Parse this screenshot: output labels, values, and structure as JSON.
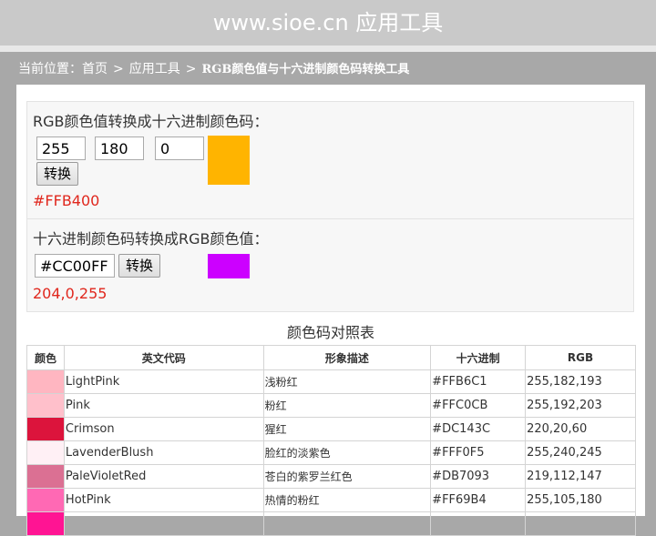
{
  "header": {
    "site_title": "www.sioe.cn 应用工具"
  },
  "breadcrumb": {
    "prefix": "当前位置：",
    "home": "首页",
    "tools": "应用工具",
    "separator": ">",
    "current": "RGB颜色值与十六进制颜色码转换工具"
  },
  "rgb_to_hex": {
    "title": "RGB颜色值转换成十六进制颜色码：",
    "r": "255",
    "g": "180",
    "b": "0",
    "button_label": "转换",
    "result": "#FFB400",
    "swatch_color": "#FFB400"
  },
  "hex_to_rgb": {
    "title": "十六进制颜色码转换成RGB颜色值：",
    "hex": "#CC00FF",
    "button_label": "转换",
    "result": "204,0,255",
    "swatch_color": "#CC00FF"
  },
  "table": {
    "caption": "颜色码对照表",
    "headers": [
      "颜色",
      "英文代码",
      "形象描述",
      "十六进制",
      "RGB"
    ],
    "rows": [
      {
        "swatch": "#FFB6C1",
        "name": "LightPink",
        "desc": "浅粉红",
        "hex": "#FFB6C1",
        "rgb": "255,182,193"
      },
      {
        "swatch": "#FFC0CB",
        "name": "Pink",
        "desc": "粉红",
        "hex": "#FFC0CB",
        "rgb": "255,192,203"
      },
      {
        "swatch": "#DC143C",
        "name": "Crimson",
        "desc": "猩红",
        "hex": "#DC143C",
        "rgb": "220,20,60"
      },
      {
        "swatch": "#FFF0F5",
        "name": "LavenderBlush",
        "desc": "脸红的淡紫色",
        "hex": "#FFF0F5",
        "rgb": "255,240,245"
      },
      {
        "swatch": "#DB7093",
        "name": "PaleVioletRed",
        "desc": "苍白的紫罗兰红色",
        "hex": "#DB7093",
        "rgb": "219,112,147"
      },
      {
        "swatch": "#FF69B4",
        "name": "HotPink",
        "desc": "热情的粉红",
        "hex": "#FF69B4",
        "rgb": "255,105,180"
      },
      {
        "swatch": "#FF1493",
        "name": "",
        "desc": "",
        "hex": "",
        "rgb": ""
      }
    ]
  }
}
